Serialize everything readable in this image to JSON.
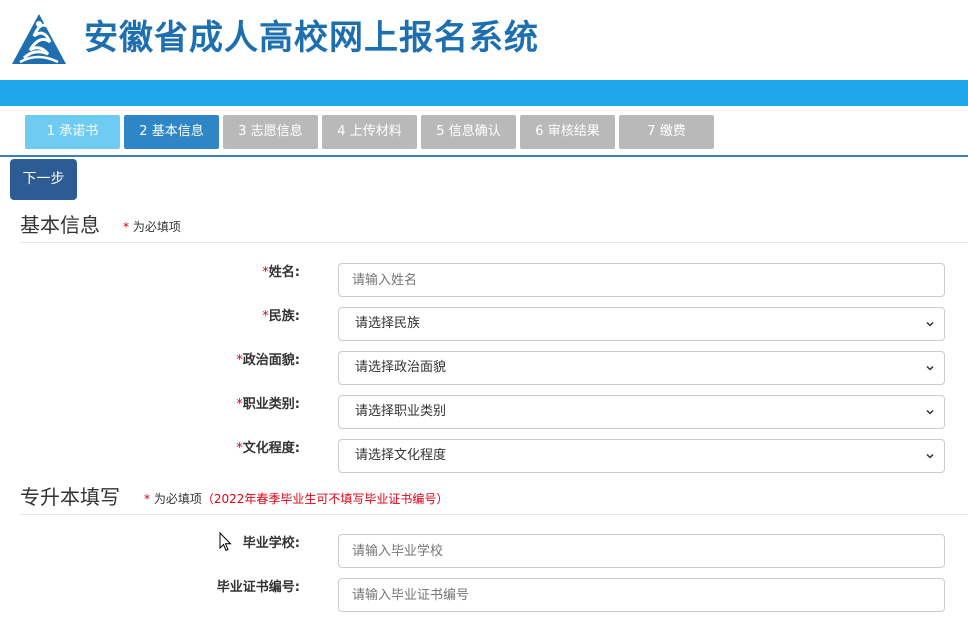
{
  "header": {
    "title": "安徽省成人高校网上报名系统",
    "logo_icon": "book-flame-logo-icon",
    "title_color": "#1e6fb0",
    "bar_color": "#1ea7ea"
  },
  "steps": [
    {
      "label": "1 承诺书",
      "state": "done"
    },
    {
      "label": "2 基本信息",
      "state": "active"
    },
    {
      "label": "3 志愿信息",
      "state": "todo"
    },
    {
      "label": "4 上传材料",
      "state": "todo"
    },
    {
      "label": "5 信息确认",
      "state": "todo"
    },
    {
      "label": "6 审核结果",
      "state": "todo"
    },
    {
      "label": "7 缴费",
      "state": "todo"
    }
  ],
  "toolbar": {
    "next_label": "下一步"
  },
  "basic_info": {
    "title": "基本信息",
    "required_star": "*",
    "required_note": " 为必填项",
    "name_label": "姓名:",
    "name_placeholder": "请输入姓名",
    "ethnicity_label": "民族:",
    "ethnicity_value": "请选择民族",
    "political_label": "政治面貌:",
    "political_value": "请选择政治面貌",
    "occupation_label": "职业类别:",
    "occupation_value": "请选择职业类别",
    "education_label": "文化程度:",
    "education_value": "请选择文化程度"
  },
  "upgrade": {
    "title": "专升本填写",
    "required_star": "*",
    "required_note": " 为必填项",
    "red_note": "（2022年春季毕业生可不填写毕业证书编号）",
    "school_label": "毕业学校:",
    "school_placeholder": "请输入毕业学校",
    "cert_label": "毕业证书编号:",
    "cert_placeholder": "请输入毕业证书编号"
  },
  "colors": {
    "step_done": "#6ecbf2",
    "step_active": "#2e86c7",
    "step_todo": "#b9b9b9",
    "next_button": "#2d5c94",
    "required": "#d9001b"
  }
}
